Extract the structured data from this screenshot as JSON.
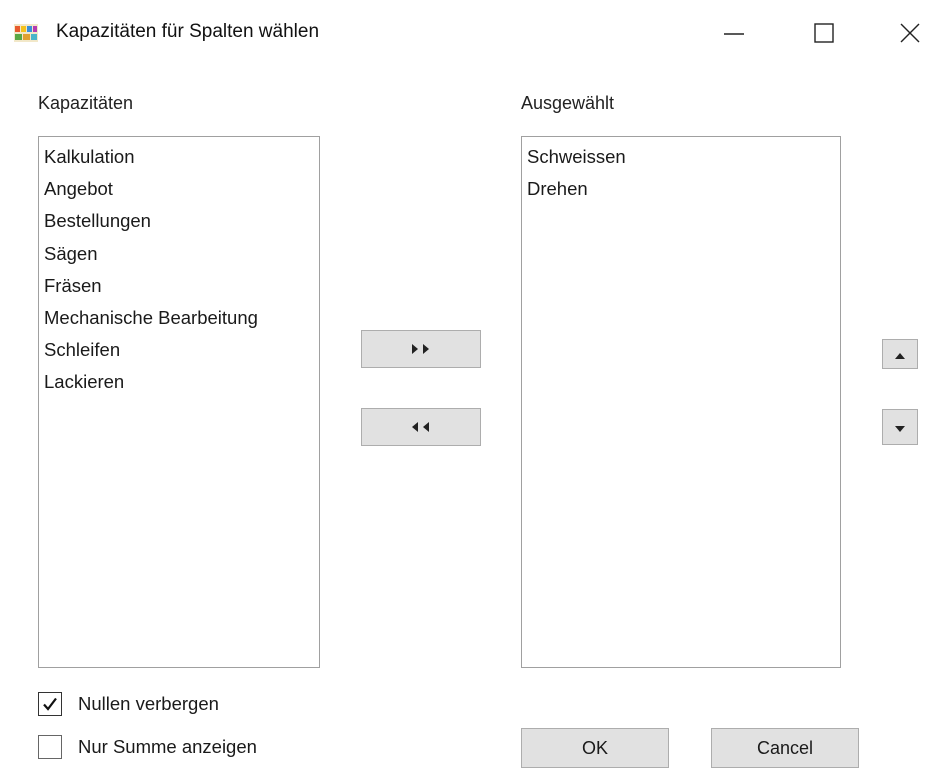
{
  "window": {
    "title": "Kapazitäten für Spalten wählen",
    "icon": "app-icon",
    "controls": {
      "minimize_icon": "minimize-icon",
      "maximize_icon": "maximize-icon",
      "close_icon": "close-icon"
    }
  },
  "available": {
    "label": "Kapazitäten",
    "items": [
      "Kalkulation",
      "Angebot",
      "Bestellungen",
      "Sägen",
      "Fräsen",
      "Mechanische Bearbeitung",
      "Schleifen",
      "Lackieren"
    ]
  },
  "selected": {
    "label": "Ausgewählt",
    "items": [
      "Schweissen",
      "Drehen"
    ]
  },
  "transfer": {
    "add_icon": "double-arrow-right-icon",
    "remove_icon": "double-arrow-left-icon"
  },
  "order": {
    "up_icon": "arrow-up-icon",
    "down_icon": "arrow-down-icon"
  },
  "options": {
    "hide_zeros": {
      "label": "Nullen verbergen",
      "checked": true
    },
    "sum_only": {
      "label": "Nur Summe anzeigen",
      "checked": false
    }
  },
  "footer": {
    "ok_label": "OK",
    "cancel_label": "Cancel"
  }
}
